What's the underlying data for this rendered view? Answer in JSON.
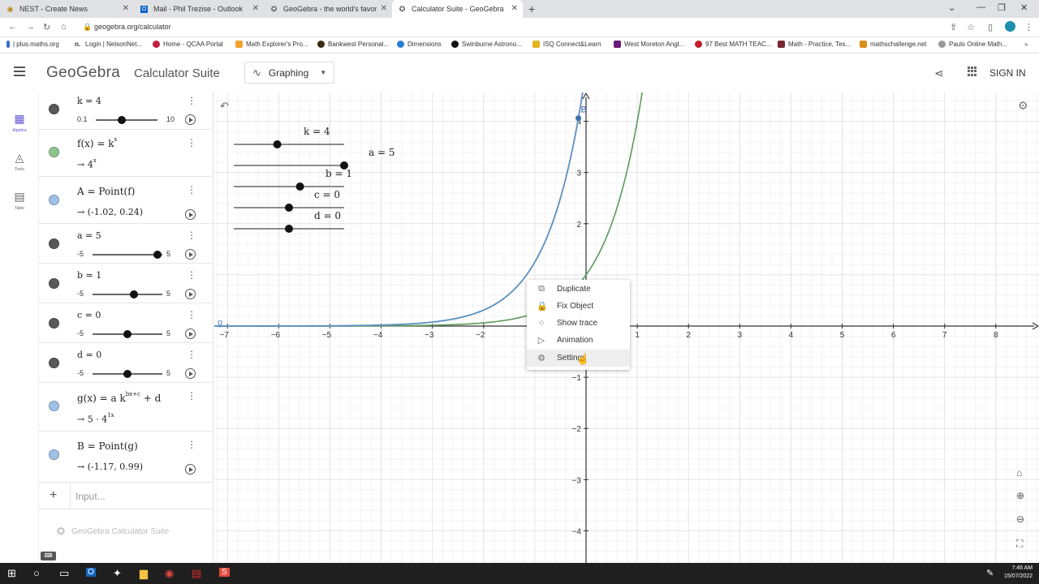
{
  "browser": {
    "tabs": [
      {
        "title": "NEST - Create News",
        "icon": "nest-icon"
      },
      {
        "title": "Mail - Phil Trezise - Outlook",
        "icon": "outlook-icon"
      },
      {
        "title": "GeoGebra - the world's favorite, fr",
        "icon": "geogebra-icon"
      },
      {
        "title": "Calculator Suite - GeoGebra",
        "icon": "geogebra-icon"
      }
    ],
    "url": "geogebra.org/calculator",
    "bookmarks": [
      "| plus.maths.org",
      "Login | NelsonNet...",
      "Home - QCAA Portal",
      "Math Explorer's Pro...",
      "Bankwest Personal...",
      "Dimensions",
      "Swinburne Astrono...",
      "ISQ Connect&Learn",
      "West Moreton Angl...",
      "97 Best MATH TEAC...",
      "Math - Practice, Tes...",
      "mathschallenge.net",
      "Pauls Online Math..."
    ]
  },
  "header": {
    "logo": "GeoGebra",
    "suite": "Calculator Suite",
    "mode": "Graphing",
    "signin": "SIGN IN"
  },
  "rail": [
    {
      "label": "Algebra",
      "icon": "calculator-icon"
    },
    {
      "label": "Tools",
      "icon": "shapes-icon"
    },
    {
      "label": "Table",
      "icon": "table-icon"
    }
  ],
  "algebra": {
    "k": {
      "expr": "k = 4",
      "min": "0.1",
      "max": "10",
      "value": 4
    },
    "f": {
      "expr": "f(x) = k",
      "exp": "x",
      "result": "→ 4",
      "result_exp": "x"
    },
    "A": {
      "expr": "A = Point(f)",
      "result": "→ (-1.02, 0.24)"
    },
    "a": {
      "expr": "a = 5",
      "min": "-5",
      "max": "5",
      "value": 5
    },
    "b": {
      "expr": "b = 1",
      "min": "-5",
      "max": "5",
      "value": 1
    },
    "c": {
      "expr": "c = 0",
      "min": "-5",
      "max": "5",
      "value": 0
    },
    "d": {
      "expr": "d = 0",
      "min": "-5",
      "max": "5",
      "value": 0
    },
    "g": {
      "expr": "g(x) = a k",
      "exp": "bx+c",
      "tail": "+ d",
      "result": "→ 5 · 4",
      "result_exp": "1x"
    },
    "B": {
      "expr": "B = Point(g)",
      "result": "→ (-1.17, 0.99)"
    },
    "input_placeholder": "Input...",
    "suite_link": "GeoGebra Calculator Suite"
  },
  "graph_sliders": [
    {
      "label": "k = 4",
      "value": 4,
      "min": 0.1,
      "max": 10
    },
    {
      "label": "a = 5",
      "value": 5,
      "min": -5,
      "max": 5
    },
    {
      "label": "b = 1",
      "value": 1,
      "min": -5,
      "max": 5
    },
    {
      "label": "c = 0",
      "value": 0,
      "min": -5,
      "max": 5
    },
    {
      "label": "d = 0",
      "value": 0,
      "min": -5,
      "max": 5
    }
  ],
  "graph": {
    "xticks": [
      "-7",
      "-6",
      "-5",
      "-4",
      "-3",
      "-2",
      "1",
      "2",
      "3",
      "4",
      "5",
      "6",
      "7",
      "8"
    ],
    "yticks": [
      "4",
      "3",
      "2",
      "-1",
      "-2",
      "-3",
      "-4"
    ],
    "point_B_label": "B",
    "g_label": "g",
    "colors": {
      "f": "#5a9a5a",
      "g": "#5b8fc1",
      "axis": "#333"
    }
  },
  "context_menu": [
    {
      "label": "Duplicate",
      "icon": "duplicate-icon"
    },
    {
      "label": "Fix Object",
      "icon": "lock-icon"
    },
    {
      "label": "Show trace",
      "icon": "trace-icon"
    },
    {
      "label": "Animation",
      "icon": "play-icon"
    },
    {
      "label": "Settings",
      "icon": "gear-icon"
    }
  ],
  "taskbar": {
    "time": "7:46 AM",
    "date": "15/07/2022"
  }
}
